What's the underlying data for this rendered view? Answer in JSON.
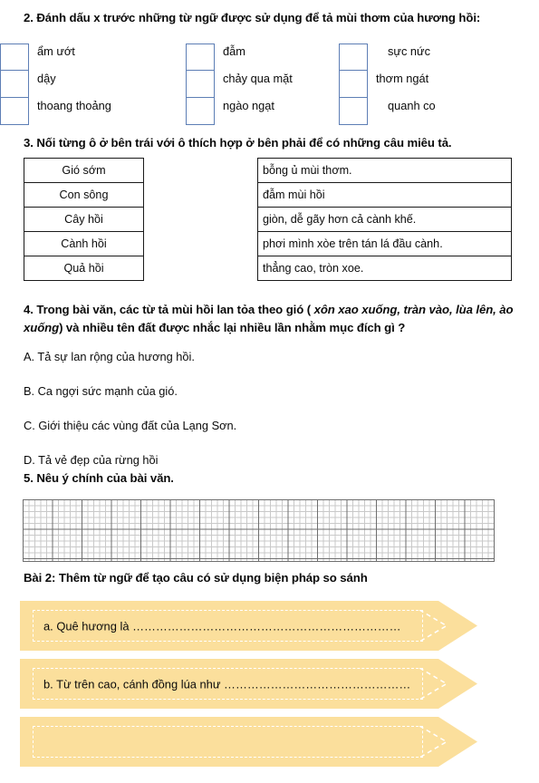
{
  "section2": {
    "title": "2. Đánh dấu x trước những từ ngữ được sử dụng để tả mùi thơm của hương hồi:",
    "columns": [
      {
        "items": [
          "ẩm ướt",
          "dậy",
          "thoang thoảng"
        ]
      },
      {
        "items": [
          "đẫm",
          "chảy qua mặt",
          "ngào ngạt"
        ]
      },
      {
        "items": [
          "sực nức",
          "thơm ngát",
          "quanh co"
        ]
      }
    ]
  },
  "section3": {
    "title": "3. Nối từng ô ở bên trái với ô thích hợp ở bên phải để có những câu miêu tả.",
    "left_items": [
      "Gió sớm",
      "Con sông",
      "Cây hồi",
      "Cành hồi",
      "Quả hồi"
    ],
    "right_items": [
      "bỗng ủ mùi thơm.",
      "đẫm mùi hồi",
      "giòn, dễ gãy hơn cả cành khế.",
      "phơi mình xòe trên tán lá đầu cành.",
      "thẳng cao, tròn xoe."
    ]
  },
  "section4": {
    "title_part1": "4. Trong bài văn, các từ tả mùi hồi lan tỏa theo gió ( ",
    "title_italic": "xôn xao xuống, tràn vào, lùa lên, ào xuống",
    "title_part2": ") và nhiều tên đất được nhắc lại nhiều lần nhằm mục đích gì ?",
    "options": [
      "A. Tả sự lan rộng của hương hồi.",
      "B. Ca ngợi sức mạnh của gió.",
      "C. Giới thiệu các vùng đất của Lạng Sơn.",
      "D. Tả vẻ đẹp của rừng hồi"
    ]
  },
  "section5": {
    "title": "5. Nêu ý chính của bài văn."
  },
  "bai2": {
    "title": "Bài 2: Thêm từ ngữ để tạo câu có sử dụng biện pháp so sánh",
    "banners": [
      {
        "text": "a. Quê hương là ……………………………………………………………"
      },
      {
        "text": "b. Từ trên cao, cánh đồng lúa như …………………………………………"
      },
      {
        "text": ""
      }
    ]
  },
  "colors": {
    "banner_fill": "#fbdf9c",
    "checkbox_border": "#5d7eb5",
    "table_border": "#1a1a1a",
    "grid_major": "#6e6e6e",
    "grid_minor": "#c9c9c9"
  }
}
